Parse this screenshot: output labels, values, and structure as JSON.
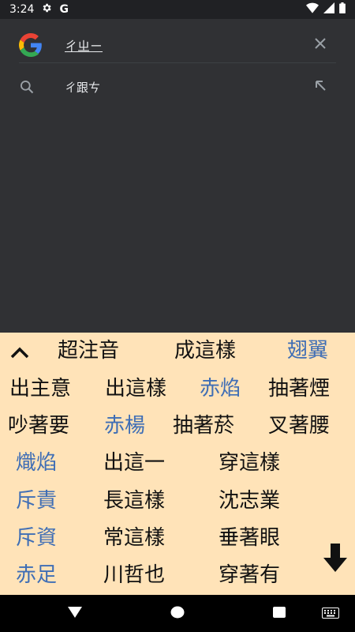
{
  "status_bar": {
    "time": "3:24",
    "g_label": "G"
  },
  "search": {
    "query": "ㄔㄓㄧ"
  },
  "suggestion": {
    "text": "ㄔ跟ㄘ"
  },
  "candidates": [
    {
      "text": "超注音",
      "highlight": false
    },
    {
      "text": "成這樣",
      "highlight": false
    },
    {
      "text": "翅翼",
      "highlight": true
    },
    {
      "text": "出主意",
      "highlight": false
    },
    {
      "text": "出這樣",
      "highlight": false
    },
    {
      "text": "赤焰",
      "highlight": true
    },
    {
      "text": "抽著煙",
      "highlight": false
    },
    {
      "text": "吵著要",
      "highlight": false
    },
    {
      "text": "赤楊",
      "highlight": true
    },
    {
      "text": "抽著菸",
      "highlight": false
    },
    {
      "text": "叉著腰",
      "highlight": false
    },
    {
      "text": "熾焰",
      "highlight": true
    },
    {
      "text": "出這一",
      "highlight": false
    },
    {
      "text": "穿這樣",
      "highlight": false
    },
    {
      "text": "斥責",
      "highlight": true
    },
    {
      "text": "長這樣",
      "highlight": false
    },
    {
      "text": "沈志業",
      "highlight": false
    },
    {
      "text": "斥資",
      "highlight": true
    },
    {
      "text": "常這樣",
      "highlight": false
    },
    {
      "text": "垂著眼",
      "highlight": false
    },
    {
      "text": "赤足",
      "highlight": true
    },
    {
      "text": "川哲也",
      "highlight": false
    },
    {
      "text": "穿著有",
      "highlight": false
    }
  ],
  "colors": {
    "panel_bg": "#ffe3b8",
    "candidate_text": "#111111",
    "highlight_text": "#3f6eb5",
    "search_bg": "#303134"
  }
}
